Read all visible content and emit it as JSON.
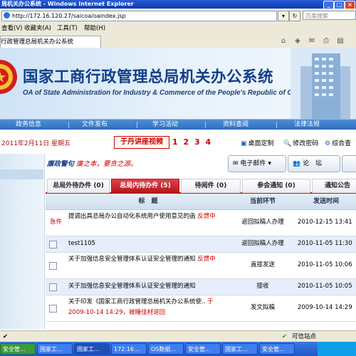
{
  "window": {
    "title": "局机关办公系统 - Windows Internet Explorer",
    "address": "http://172.16.120.27/saicoa/oaindex.jsp",
    "search_placeholder": "百度搜索"
  },
  "menu": [
    "查看(V)",
    "收藏夹(A)",
    "工具(T)",
    "帮助(H)"
  ],
  "browser_tab": {
    "label": "行政管理总局机关办公系统"
  },
  "banner": {
    "title": "国家工商行政管理总局机关办公系统",
    "subtitle": "OA of State Administration for Industry & Commerce of the People's Republic of China"
  },
  "nav": [
    "政务信息",
    "文件发布",
    "学习活动",
    "资料查阅",
    "法律法规"
  ],
  "date_text": "2011年2月11日 星期五",
  "video_label": "于丹讲座视频",
  "page_numbers": "1 2 3 4",
  "top_links": {
    "desktop": "桌面定制",
    "password": "修改密码",
    "portal": "综合查"
  },
  "warning": {
    "prefix": "廉政警句",
    "text": "廉之本，要贪之源。"
  },
  "buttons": {
    "email": "电子邮件",
    "forum": "论　坛"
  },
  "tabs": [
    {
      "label": "总局外待办件 (0)",
      "active": false
    },
    {
      "label": "总局内待办件 (5)",
      "active": true
    },
    {
      "label": "待阅件 (0)",
      "active": false
    },
    {
      "label": "参会通知 (0)",
      "active": false
    },
    {
      "label": "通知公告",
      "active": false
    }
  ],
  "table": {
    "headers": {
      "title": "标　题",
      "step": "当前环节",
      "time": "发送时间"
    },
    "rows": [
      {
        "urgent": "急件",
        "title": "提调出具总局办公自动化系统用户使用意见的函",
        "tail": "反馈中",
        "step": "返回拟稿人办理",
        "time": "2010-12-15 13:41"
      },
      {
        "urgent": "",
        "title": "test1105",
        "tail": "",
        "step": "返回拟稿人办理",
        "time": "2010-11-05 11:30"
      },
      {
        "urgent": "",
        "title": "关于加强信息安全管理体系认证安全管理的通知",
        "tail": "反馈中",
        "step": "直接发送",
        "time": "2010-11-05 10:06"
      },
      {
        "urgent": "",
        "title": "关于加强信息安全管理体系认证安全管理的通知",
        "tail": "",
        "step": "接收",
        "time": "2010-11-05 10:05"
      },
      {
        "urgent": "",
        "title": "关于印发《国家工商行政管理总局机关办公系统使..",
        "tail": "于2009-10-14 14:29，被睡佳材退回",
        "step": "发文拟稿",
        "time": "2009-10-14 14:29"
      }
    ]
  },
  "status_bar": {
    "zone": "可信站点"
  },
  "taskbar": [
    "安全管...",
    "国家工...",
    "国家工...",
    "172.16...",
    "OS数据...",
    "安全管...",
    "国家工...",
    "安全管..."
  ],
  "colors": {
    "accent_red": "#c0141a",
    "nav_blue": "#2b6bbd",
    "banner_title": "#113e8a"
  }
}
